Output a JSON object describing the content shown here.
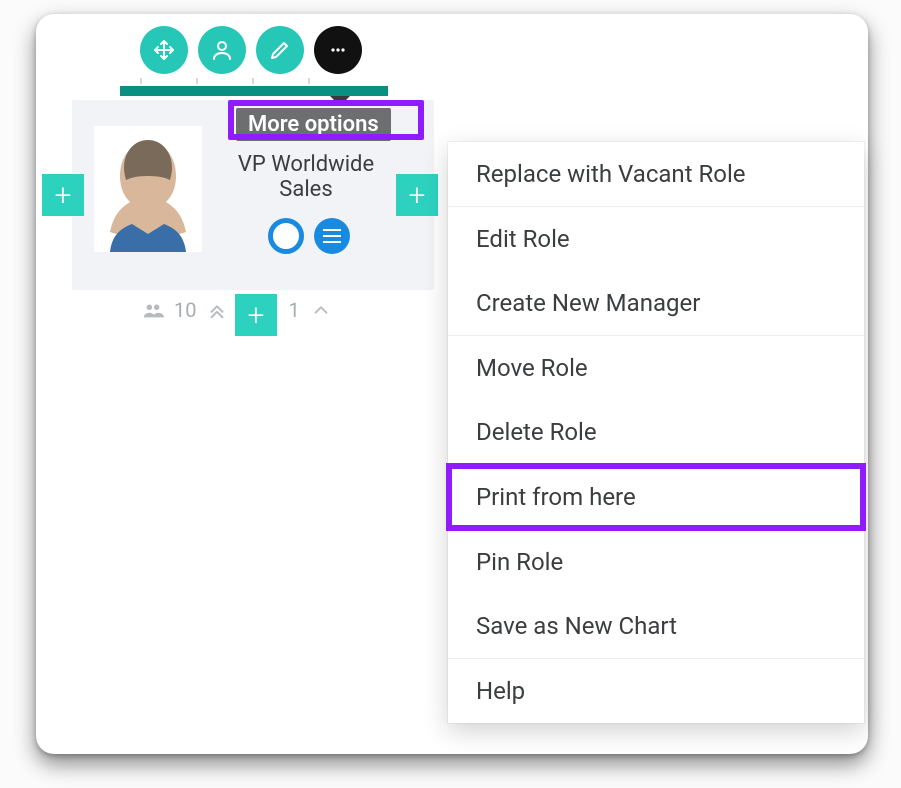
{
  "card": {
    "tooltip": "More options",
    "role_title": "VP Worldwide Sales",
    "toolbar_icons": {
      "move": "move-icon",
      "person": "person-icon",
      "edit": "pencil-icon",
      "more": "more-icon"
    },
    "add_label": "+",
    "stats": {
      "people_count": "10",
      "levels_count": "1"
    },
    "chips": {
      "outline": "ring-icon",
      "detail": "lines-icon"
    }
  },
  "menu": {
    "groups": [
      {
        "items": [
          "Replace with Vacant Role"
        ]
      },
      {
        "items": [
          "Edit Role",
          "Create New Manager"
        ]
      },
      {
        "items": [
          "Move Role",
          "Delete Role"
        ]
      },
      {
        "items": [
          "Print from here"
        ],
        "highlight": 0
      },
      {
        "items": [
          "Pin Role",
          "Save as New Chart"
        ]
      },
      {
        "items": [
          "Help"
        ]
      }
    ]
  },
  "colors": {
    "accent_teal": "#26c7b7",
    "accent_teal_dark": "#0b8f81",
    "highlight_purple": "#8f1bff",
    "info_blue": "#188be0"
  }
}
